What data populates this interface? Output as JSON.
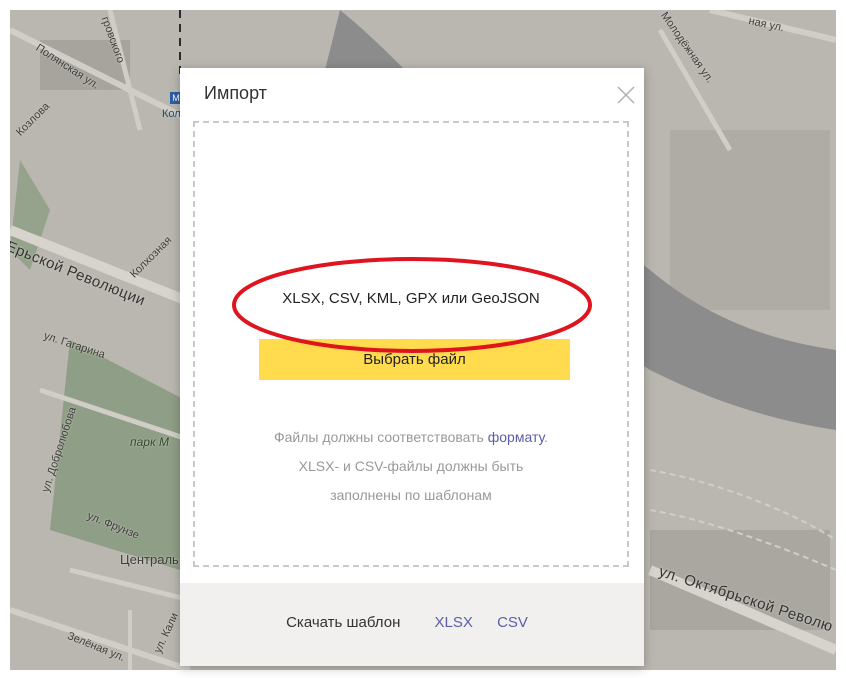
{
  "map": {
    "labels": {
      "polyanskaya": "Полянская ул.",
      "kolkhoznaya": "Колхозная",
      "revolution": "Ерьской Революции",
      "gagarina": "ул. Гагарина",
      "park": "парк М",
      "dobrolyubova": "ул. Добролюбова",
      "frunze": "ул. Фрунзе",
      "central": "Централь",
      "kalinina": "ул. Кали",
      "zelenaya": "Зелёная ул.",
      "oktyabrskoy": "ул. Октябрьской Револю",
      "molodezhnaya": "Молодёжная ул.",
      "top_right": "ная ул.",
      "metro_label": "Коло",
      "top_left": "гровского",
      "kozlova": "Козлова"
    }
  },
  "dialog": {
    "title": "Импорт",
    "formats": "XLSX, CSV, KML, GPX или GeoJSON",
    "choose_button": "Выбрать файл",
    "hint_prefix": "Файлы должны соответствовать ",
    "hint_link": "формату",
    "hint_suffix": ".",
    "hint_line2": "XLSX- и CSV-файлы должны быть",
    "hint_line3": "заполнены по шаблонам",
    "footer": {
      "download_label": "Скачать шаблон",
      "xlsx": "XLSX",
      "csv": "CSV"
    }
  },
  "colors": {
    "button": "#ffdb4d",
    "link": "#5b5ea6",
    "highlight_ellipse": "#e0141e"
  }
}
